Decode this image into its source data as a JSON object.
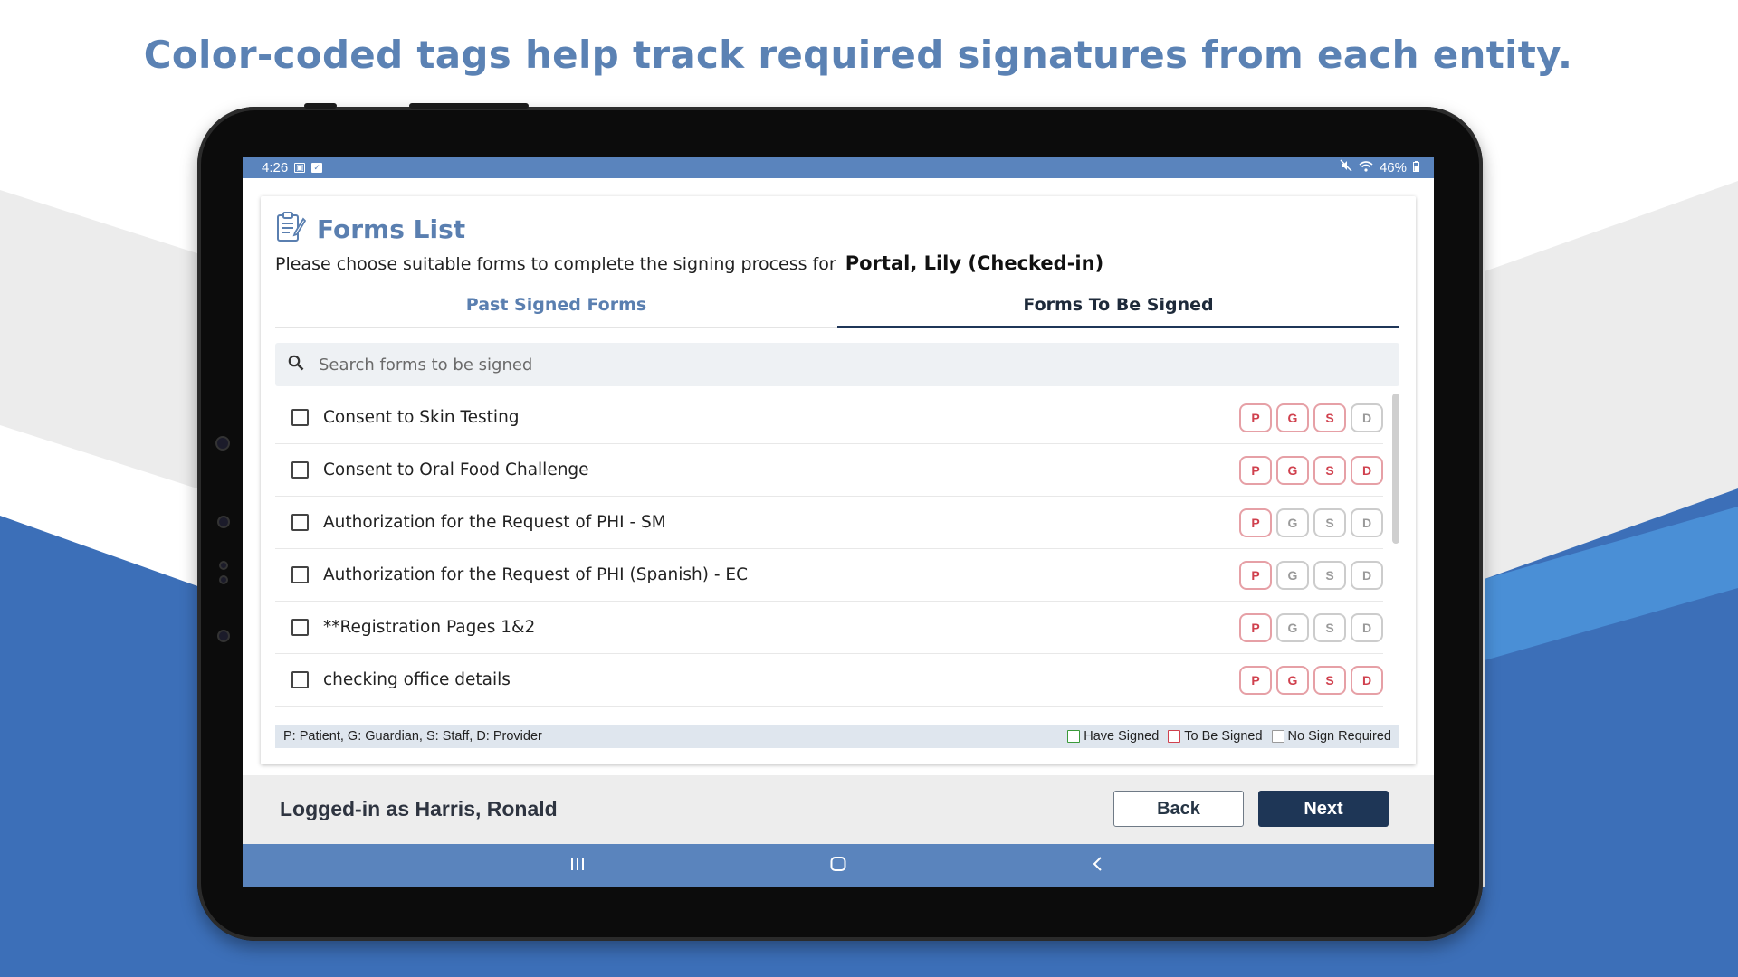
{
  "headline": "Color-coded tags help track required signatures from each entity.",
  "status_bar": {
    "time": "4:26",
    "battery": "46%",
    "left_icons": [
      "image-icon",
      "check-box-icon"
    ],
    "right_icons": [
      "mute-icon",
      "wifi-icon",
      "battery-icon"
    ]
  },
  "forms_list": {
    "title": "Forms List",
    "title_icon": "document-edit-icon",
    "subtitle_prefix": "Please choose suitable forms to complete the signing process for",
    "patient_name": "Portal, Lily (Checked-in)",
    "tabs": [
      {
        "label": "Past Signed Forms",
        "active": false
      },
      {
        "label": "Forms To Be Signed",
        "active": true
      }
    ],
    "search": {
      "placeholder": "Search forms to be signed",
      "value": "",
      "icon": "search-icon"
    },
    "forms": [
      {
        "label": "Consent to Skin Testing",
        "checked": false,
        "tags": [
          {
            "letter": "P",
            "status": "to-be-signed"
          },
          {
            "letter": "G",
            "status": "to-be-signed"
          },
          {
            "letter": "S",
            "status": "to-be-signed"
          },
          {
            "letter": "D",
            "status": "no-sign-required"
          }
        ]
      },
      {
        "label": "Consent to Oral Food Challenge",
        "checked": false,
        "tags": [
          {
            "letter": "P",
            "status": "to-be-signed"
          },
          {
            "letter": "G",
            "status": "to-be-signed"
          },
          {
            "letter": "S",
            "status": "to-be-signed"
          },
          {
            "letter": "D",
            "status": "to-be-signed"
          }
        ]
      },
      {
        "label": "Authorization for the Request of PHI - SM",
        "checked": false,
        "tags": [
          {
            "letter": "P",
            "status": "to-be-signed"
          },
          {
            "letter": "G",
            "status": "no-sign-required"
          },
          {
            "letter": "S",
            "status": "no-sign-required"
          },
          {
            "letter": "D",
            "status": "no-sign-required"
          }
        ]
      },
      {
        "label": "Authorization for the Request of PHI (Spanish) - EC",
        "checked": false,
        "tags": [
          {
            "letter": "P",
            "status": "to-be-signed"
          },
          {
            "letter": "G",
            "status": "no-sign-required"
          },
          {
            "letter": "S",
            "status": "no-sign-required"
          },
          {
            "letter": "D",
            "status": "no-sign-required"
          }
        ]
      },
      {
        "label": "**Registration Pages 1&2",
        "checked": false,
        "tags": [
          {
            "letter": "P",
            "status": "to-be-signed"
          },
          {
            "letter": "G",
            "status": "no-sign-required"
          },
          {
            "letter": "S",
            "status": "no-sign-required"
          },
          {
            "letter": "D",
            "status": "no-sign-required"
          }
        ]
      },
      {
        "label": "checking office details",
        "checked": false,
        "tags": [
          {
            "letter": "P",
            "status": "to-be-signed"
          },
          {
            "letter": "G",
            "status": "to-be-signed"
          },
          {
            "letter": "S",
            "status": "to-be-signed"
          },
          {
            "letter": "D",
            "status": "to-be-signed"
          }
        ]
      }
    ],
    "legend": {
      "key_text": "P: Patient, G: Guardian, S: Staff, D: Provider",
      "have_signed": "Have Signed",
      "to_be_signed": "To Be Signed",
      "no_sign_required": "No Sign Required"
    }
  },
  "footer": {
    "logged_in_text": "Logged-in as Harris, Ronald",
    "back_label": "Back",
    "next_label": "Next"
  },
  "nav_bar": {
    "recents_icon": "recents-icon",
    "home_icon": "home-icon",
    "back_icon": "back-icon"
  },
  "colors": {
    "headline": "#5b82b4",
    "status_bar": "#5a84bd",
    "have_signed": "#3a9a3a",
    "to_be_signed": "#d0414e",
    "no_sign_required": "#9a9a9a",
    "next_button": "#1e3656"
  }
}
